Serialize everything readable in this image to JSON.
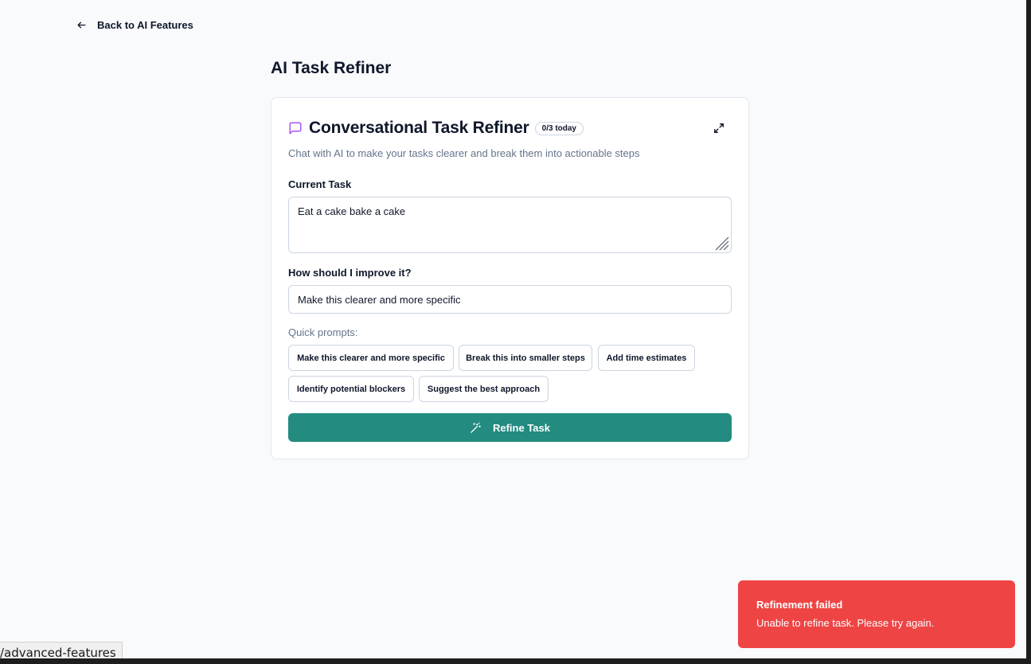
{
  "nav": {
    "back_label": "Back to AI Features"
  },
  "page": {
    "title": "AI Task Refiner"
  },
  "card": {
    "title": "Conversational Task Refiner",
    "usage_badge": "0/3 today",
    "description": "Chat with AI to make your tasks clearer and break them into actionable steps",
    "current_task_label": "Current Task",
    "current_task_value": "Eat a cake bake a cake",
    "improve_label": "How should I improve it?",
    "improve_value": "Make this clearer and more specific",
    "quick_prompts_label": "Quick prompts:",
    "quick_prompts": [
      "Make this clearer and more specific",
      "Break this into smaller steps",
      "Add time estimates",
      "Identify potential blockers",
      "Suggest the best approach"
    ],
    "refine_button": "Refine Task"
  },
  "toast": {
    "title": "Refinement failed",
    "message": "Unable to refine task. Please try again."
  },
  "status_bar": {
    "url": "/advanced-features"
  },
  "colors": {
    "accent": "#238b80",
    "error": "#ef4444",
    "chat_icon": "#a855f7"
  },
  "icons": {
    "back": "arrow-left-icon",
    "chat": "message-square-icon",
    "expand": "maximize-icon",
    "refine": "wand-icon"
  }
}
